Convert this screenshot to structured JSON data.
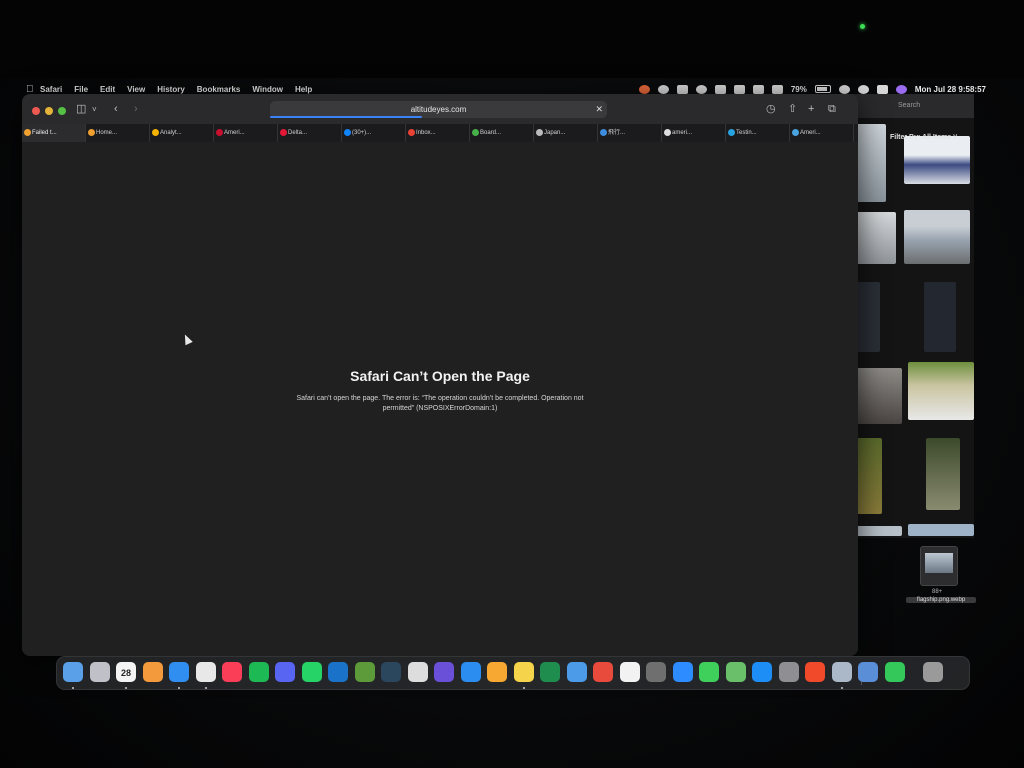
{
  "menubar": {
    "items": [
      "Safari",
      "File",
      "Edit",
      "View",
      "History",
      "Bookmarks",
      "Window",
      "Help"
    ],
    "battery_percent": "79%",
    "clock": "Mon Jul 28  9:58:57"
  },
  "safari": {
    "url": "altitudeyes.com",
    "load_progress": 0.45,
    "tabs": [
      {
        "label": "Failed t...",
        "color": "#f0a030",
        "active": true
      },
      {
        "label": "Home...",
        "color": "#f0a030"
      },
      {
        "label": "Analyt...",
        "color": "#f6b400"
      },
      {
        "label": "Ameri...",
        "color": "#c8102e"
      },
      {
        "label": "Delta...",
        "color": "#e31837"
      },
      {
        "label": "(30+)...",
        "color": "#1185fe"
      },
      {
        "label": "Inbox...",
        "color": "#ea4335"
      },
      {
        "label": "Board...",
        "color": "#48b04a"
      },
      {
        "label": "Japan...",
        "color": "#bbbbbb"
      },
      {
        "label": "飛行...",
        "color": "#3c8dde"
      },
      {
        "label": "ameri...",
        "color": "#dddddd"
      },
      {
        "label": "Testin...",
        "color": "#27a3e0"
      },
      {
        "label": "Ameri...",
        "color": "#4aa3df"
      }
    ],
    "error": {
      "title": "Safari Can’t Open the Page",
      "message": "Safari can’t open the page. The error is: “The operation couldn’t be completed. Operation not permitted” (NSPOSIXErrorDomain:1)"
    }
  },
  "photos_panel": {
    "search_placeholder": "Search",
    "filter_label": "Filter By: All Items ˅"
  },
  "download": {
    "size": "88+",
    "filename": "flagship.png.webp"
  },
  "dock": {
    "apps": [
      {
        "name": "finder-icon",
        "color": "#5aa0e8",
        "running": true
      },
      {
        "name": "launchpad-icon",
        "color": "#c0c0c8"
      },
      {
        "name": "calendar-icon",
        "color": "#f4f4f4",
        "running": true,
        "date": "28"
      },
      {
        "name": "photos-icon",
        "color": "#f29a3c"
      },
      {
        "name": "safari-icon",
        "color": "#2f8ef0",
        "running": true
      },
      {
        "name": "chrome-icon",
        "color": "#e8e8e8",
        "running": true
      },
      {
        "name": "music-icon",
        "color": "#fa3e58"
      },
      {
        "name": "spotify-icon",
        "color": "#1db954"
      },
      {
        "name": "discord-icon",
        "color": "#5865f2"
      },
      {
        "name": "whatsapp-icon",
        "color": "#25d366"
      },
      {
        "name": "outlook-icon",
        "color": "#1a73c8"
      },
      {
        "name": "minecraft-icon",
        "color": "#5d9b3a"
      },
      {
        "name": "steam-icon",
        "color": "#2a475e"
      },
      {
        "name": "window-switcher-icon",
        "color": "#dddddd"
      },
      {
        "name": "imovie-icon",
        "color": "#6a4fd8"
      },
      {
        "name": "keynote-icon",
        "color": "#2b8df0"
      },
      {
        "name": "pages-icon",
        "color": "#f6a832"
      },
      {
        "name": "notes-icon",
        "color": "#f5d34a",
        "running": true
      },
      {
        "name": "excel-icon",
        "color": "#1e8d4e"
      },
      {
        "name": "icloud-icon",
        "color": "#4b9be8"
      },
      {
        "name": "flashcards-icon",
        "color": "#e84a3c"
      },
      {
        "name": "reminders-icon",
        "color": "#f2f2f2"
      },
      {
        "name": "calculator-icon",
        "color": "#6f6f6f"
      },
      {
        "name": "zoom-icon",
        "color": "#2d8cff"
      },
      {
        "name": "messages-icon",
        "color": "#3fcf5b"
      },
      {
        "name": "maps-icon",
        "color": "#6ac06a"
      },
      {
        "name": "app-store-icon",
        "color": "#1c8ef5"
      },
      {
        "name": "system-settings-icon",
        "color": "#8e8e93"
      },
      {
        "name": "antivirus-icon",
        "color": "#f04a2a"
      },
      {
        "name": "preview-icon",
        "color": "#aab8c8",
        "running": true
      },
      {
        "name": "quicktime-icon",
        "color": "#5a8fd8"
      },
      {
        "name": "facetime-icon",
        "color": "#34c759"
      },
      {
        "name": "trash-icon",
        "color": "#9a9a9a"
      }
    ]
  }
}
